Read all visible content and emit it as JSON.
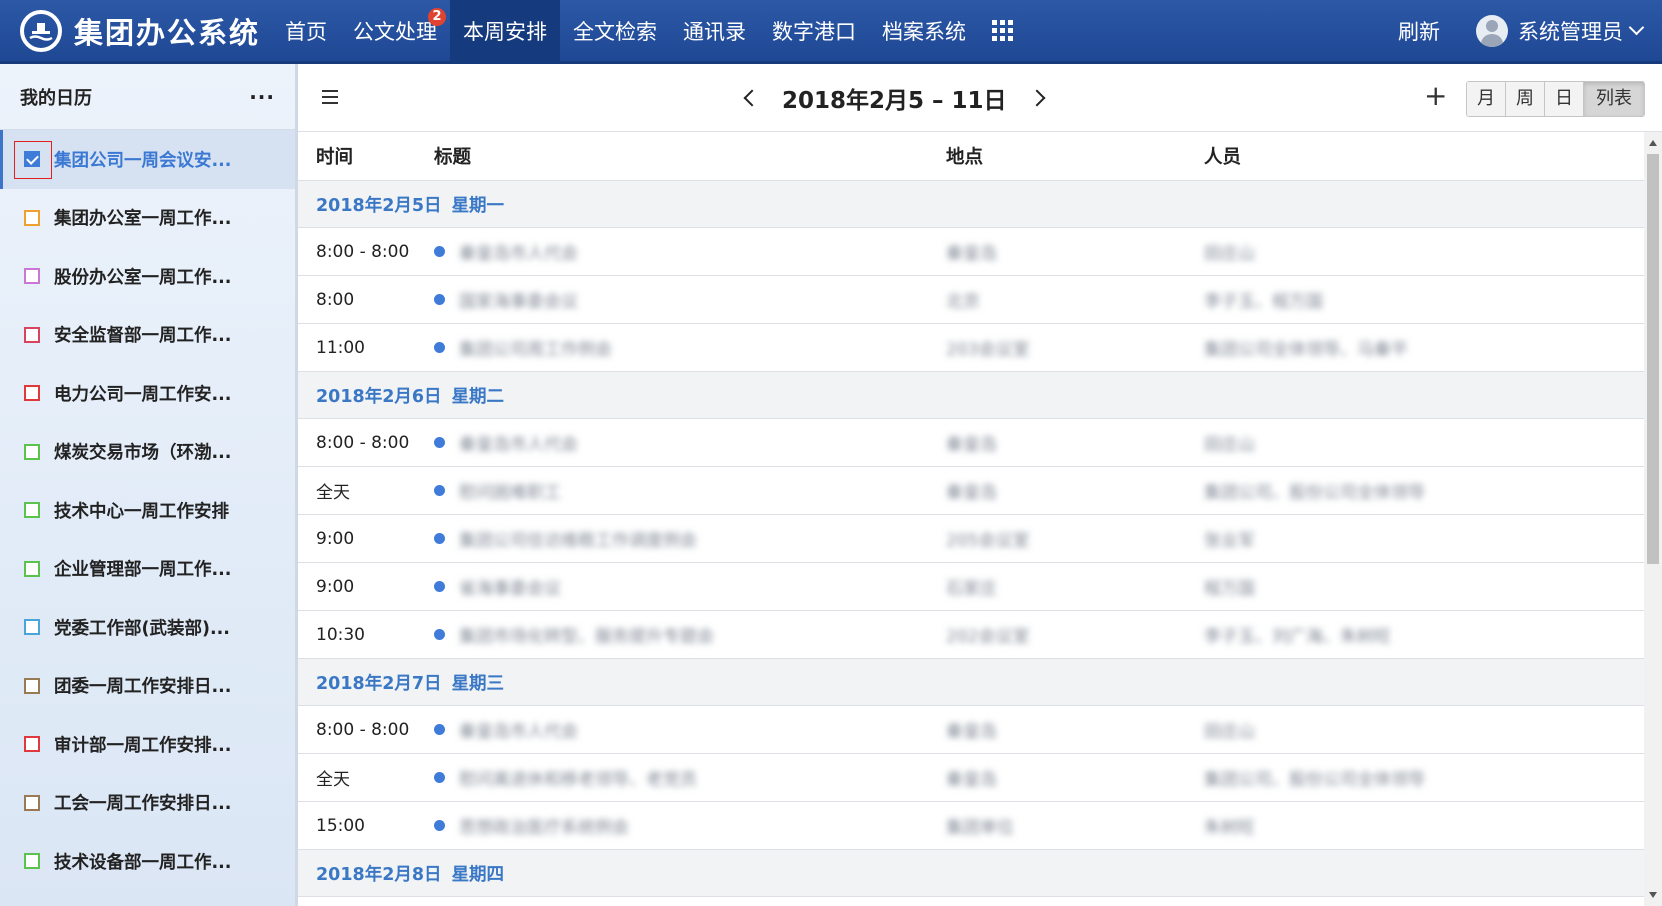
{
  "app": {
    "title": "集团办公系统"
  },
  "nav": {
    "items": [
      {
        "label": "首页"
      },
      {
        "label": "公文处理",
        "badge": "2"
      },
      {
        "label": "本周安排",
        "active": true
      },
      {
        "label": "全文检索"
      },
      {
        "label": "通讯录"
      },
      {
        "label": "数字港口"
      },
      {
        "label": "档案系统"
      }
    ],
    "refresh": "刷新",
    "user": "系统管理员"
  },
  "sidebar": {
    "title": "我的日历",
    "more": "···",
    "calendars": [
      {
        "label": "集团公司一周会议安...",
        "color": "#3f7bd9",
        "checked": true
      },
      {
        "label": "集团办公室一周工作...",
        "color": "#f0a030"
      },
      {
        "label": "股份办公室一周工作...",
        "color": "#c879d6"
      },
      {
        "label": "安全监督部一周工作...",
        "color": "#d9435f"
      },
      {
        "label": "电力公司一周工作安...",
        "color": "#e0393c"
      },
      {
        "label": "煤炭交易市场（环渤...",
        "color": "#5cc24e"
      },
      {
        "label": "技术中心一周工作安排",
        "color": "#5cc24e"
      },
      {
        "label": "企业管理部一周工作...",
        "color": "#5cc24e"
      },
      {
        "label": "党委工作部(武装部)...",
        "color": "#4aa6d9"
      },
      {
        "label": "团委一周工作安排日...",
        "color": "#9a7a55"
      },
      {
        "label": "审计部一周工作安排...",
        "color": "#e0393c"
      },
      {
        "label": "工会一周工作安排日...",
        "color": "#9a7a55"
      },
      {
        "label": "技术设备部一周工作...",
        "color": "#5cc24e"
      }
    ]
  },
  "toolbar": {
    "date_range": "2018年2月5 – 11日",
    "add": "+",
    "views": [
      {
        "label": "月"
      },
      {
        "label": "周"
      },
      {
        "label": "日"
      },
      {
        "label": "列表",
        "active": true
      }
    ]
  },
  "table": {
    "headers": {
      "time": "时间",
      "title": "标题",
      "location": "地点",
      "people": "人员"
    },
    "days": [
      {
        "date": "2018年2月5日",
        "weekday": "星期一",
        "events": [
          {
            "time": "8:00 - 8:00",
            "title": "秦皇岛市人代会",
            "location": "秦皇岛",
            "people": "田庄山"
          },
          {
            "time": "8:00",
            "title": "国家海事委会议",
            "location": "北京",
            "people": "李子玉、程万国"
          },
          {
            "time": "11:00",
            "title": "集团公司周工作例会",
            "location": "203会议室",
            "people": "集团公司全体领导、马秦平"
          }
        ]
      },
      {
        "date": "2018年2月6日",
        "weekday": "星期二",
        "events": [
          {
            "time": "8:00 - 8:00",
            "title": "秦皇岛市人代会",
            "location": "秦皇岛",
            "people": "田庄山"
          },
          {
            "time": "全天",
            "title": "慰问困难职工",
            "location": "秦皇岛",
            "people": "集团公司、股份公司全体领导"
          },
          {
            "time": "9:00",
            "title": "集团公司信访维稳工作调度例会",
            "location": "205会议室",
            "people": "张业军"
          },
          {
            "time": "9:00",
            "title": "省海事委会议",
            "location": "石家庄",
            "people": "程万国"
          },
          {
            "time": "10:30",
            "title": "集团市场化转型、服务提升专题会",
            "location": "202会议室",
            "people": "李子玉、刘广海、朱树旺"
          }
        ]
      },
      {
        "date": "2018年2月7日",
        "weekday": "星期三",
        "events": [
          {
            "time": "8:00 - 8:00",
            "title": "秦皇岛市人代会",
            "location": "秦皇岛",
            "people": "田庄山"
          },
          {
            "time": "全天",
            "title": "慰问离退休和移老领导、老党员",
            "location": "秦皇岛",
            "people": "集团公司、股份公司全体领导"
          },
          {
            "time": "15:00",
            "title": "思想政治医疗系统例会",
            "location": "集团单位",
            "people": "朱树旺"
          }
        ]
      },
      {
        "date": "2018年2月8日",
        "weekday": "星期四",
        "events": []
      }
    ]
  }
}
